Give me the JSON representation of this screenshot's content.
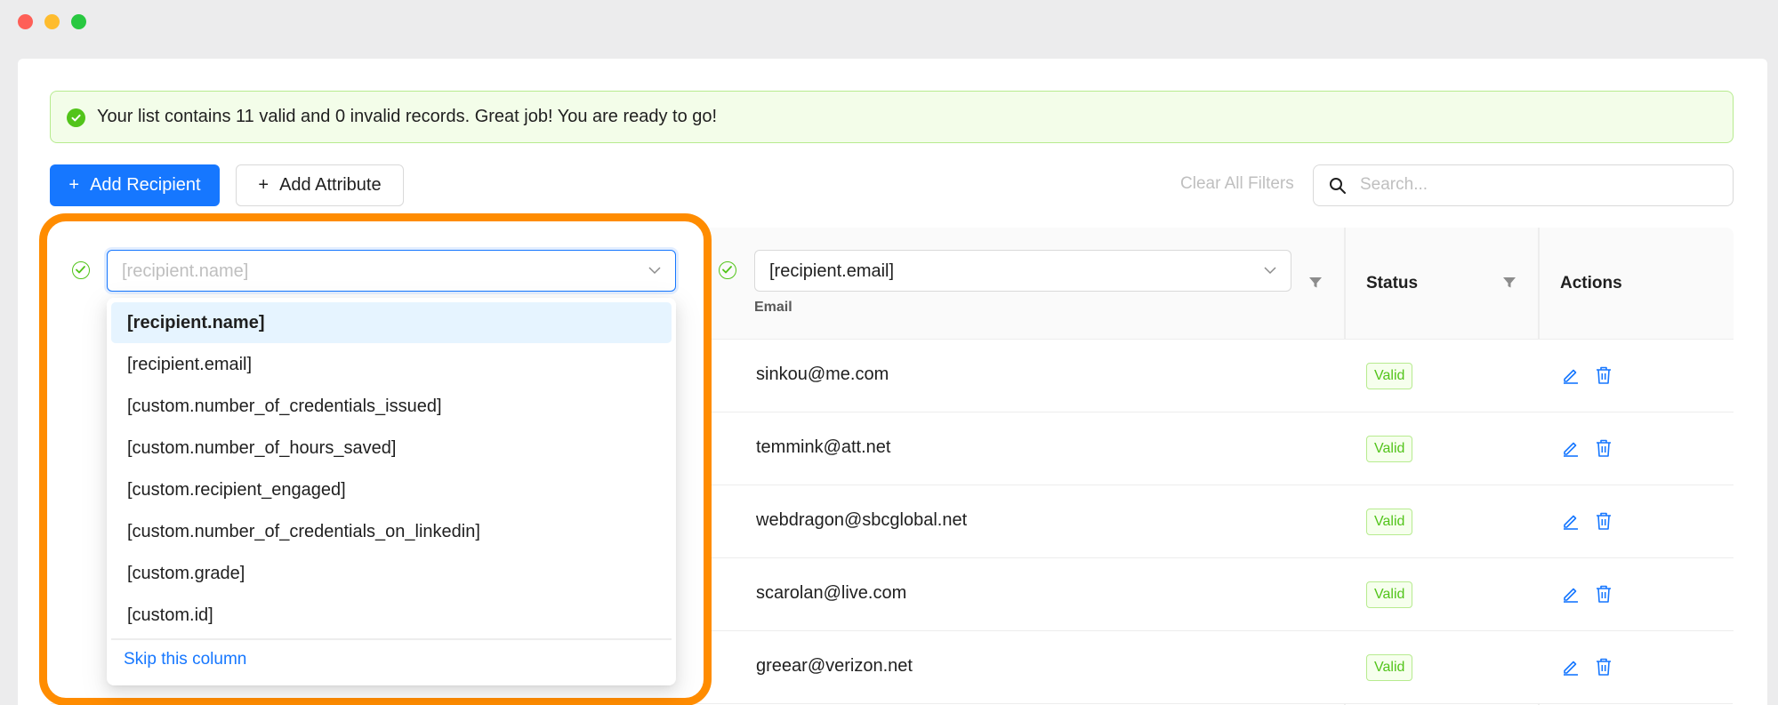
{
  "alert": {
    "text": "Your list contains 11 valid and 0 invalid records. Great job! You are ready to go!"
  },
  "toolbar": {
    "add_recipient": "Add Recipient",
    "add_attribute": "Add Attribute",
    "plus": "+",
    "clear_filters": "Clear All Filters",
    "search_placeholder": "Search..."
  },
  "columns": {
    "name_select_placeholder": "[recipient.name]",
    "email_select_value": "[recipient.email]",
    "email_sub": "Email",
    "status": "Status",
    "actions": "Actions"
  },
  "dropdown": {
    "options": [
      "[recipient.name]",
      "[recipient.email]",
      "[custom.number_of_credentials_issued]",
      "[custom.number_of_hours_saved]",
      "[custom.recipient_engaged]",
      "[custom.number_of_credentials_on_linkedin]",
      "[custom.grade]",
      "[custom.id]"
    ],
    "selected_index": 0,
    "skip": "Skip this column"
  },
  "rows": [
    {
      "email": "sinkou@me.com",
      "status": "Valid"
    },
    {
      "email": "temmink@att.net",
      "status": "Valid"
    },
    {
      "email": "webdragon@sbcglobal.net",
      "status": "Valid"
    },
    {
      "email": "scarolan@live.com",
      "status": "Valid"
    },
    {
      "email": "greear@verizon.net",
      "status": "Valid"
    }
  ],
  "colors": {
    "primary": "#1677ff",
    "success": "#52c41a",
    "highlight": "#ff8c00"
  }
}
